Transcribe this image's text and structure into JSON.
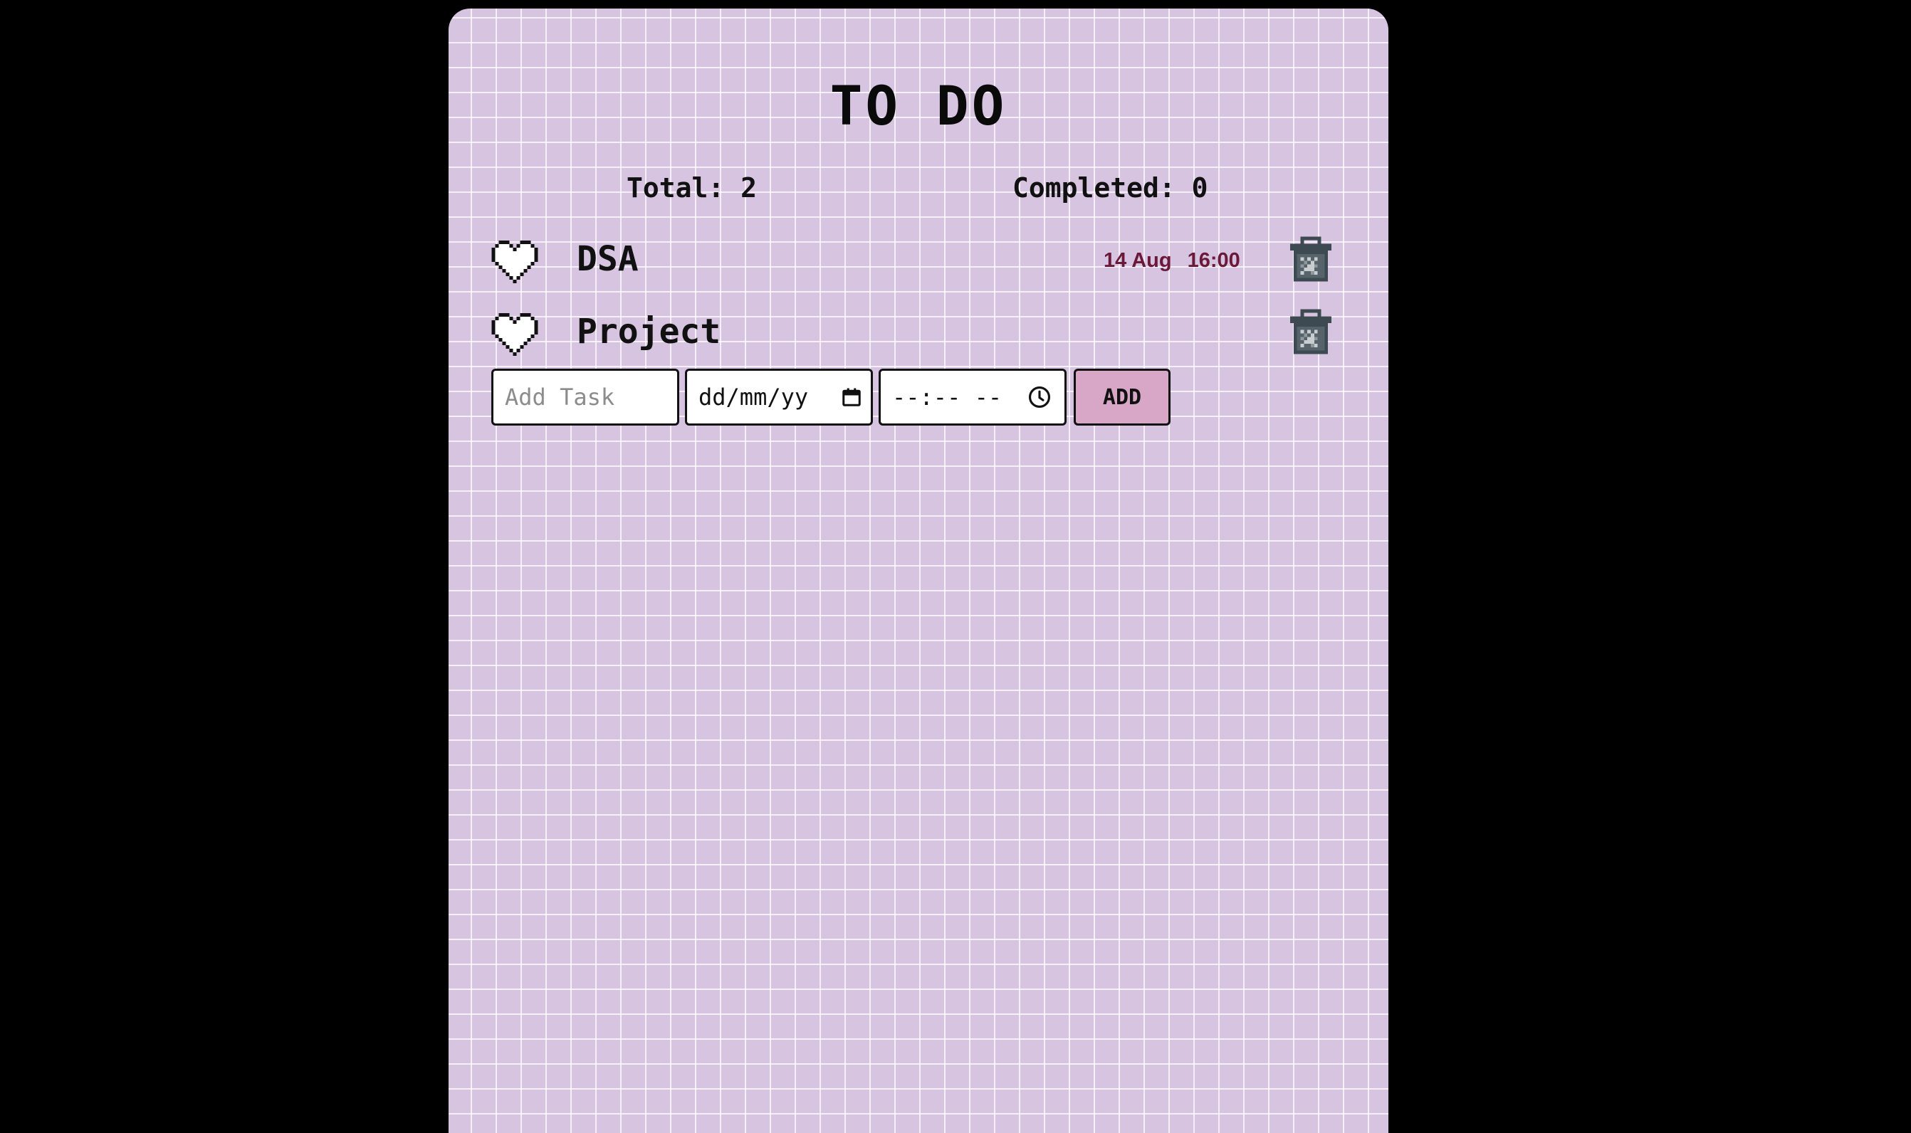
{
  "app": {
    "title": "TO DO"
  },
  "stats": {
    "total_label": "Total: 2",
    "completed_label": "Completed: 0"
  },
  "tasks": [
    {
      "name": "DSA",
      "date": "14 Aug",
      "time": "16:00",
      "liked": false,
      "icon": "heart-outline-icon",
      "delete_icon": "trash-icon"
    },
    {
      "name": "Project",
      "date": "",
      "time": "",
      "liked": false,
      "icon": "heart-outline-icon",
      "delete_icon": "trash-icon"
    }
  ],
  "form": {
    "task_placeholder": "Add Task",
    "date_value": "dd/mm/yy",
    "time_value": "--:-- --",
    "add_label": "ADD"
  },
  "colors": {
    "background": "#000000",
    "card": "#d6c4e0",
    "grid_line": "#ffffff",
    "due_text": "#6a1a38",
    "add_button": "#d8a6c6"
  }
}
